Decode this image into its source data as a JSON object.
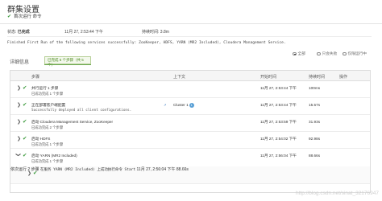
{
  "header": {
    "title": "群集设置",
    "subtitle": "首次运行 命令"
  },
  "status": {
    "state_label": "状态",
    "state_value": "已完成",
    "start_label": "11月 27, 2:53:44 下午",
    "duration_label": "持续时间",
    "duration_value": "3.8m"
  },
  "message": "Finished First Run of the following services successfully: ZooKeeper, HDFS, YARN (MR2 Included), Cloudera Management Service.",
  "details": {
    "label": "详细信息",
    "tab": "已完成 5 个步骤（共 5 个）",
    "filters": [
      "全部",
      "只会失败",
      "仅限运行中"
    ]
  },
  "table": {
    "headers": [
      "步骤",
      "上下文",
      "开始时间",
      "持续时间",
      "操作"
    ],
    "rows": [
      {
        "name": "并行运行 1 步骤",
        "status": "已成功完成 1 个步骤",
        "context": "",
        "start": "11月 27, 2:53:44 下午",
        "duration": "100ms"
      },
      {
        "name": "正在部署客户端配置",
        "status": "Successfully deployed all client configurations.",
        "context": "Cluster 1",
        "start": "11月 27, 2:53:44 下午",
        "duration": "15.57s"
      },
      {
        "name": "启动 Cloudera Management Service, ZooKeeper",
        "status": "已成功完成 2 个步骤",
        "context": "",
        "start": "11月 27, 2:53:59 下午",
        "duration": "31.93s"
      },
      {
        "name": "启动 HDFS",
        "status": "已成功完成 1 个步骤",
        "context": "",
        "start": "11月 27, 2:54:02 下午",
        "duration": "92.98s"
      },
      {
        "name": "启动 YARN (MR2 Included)",
        "status": "已成功完成 1 个步骤",
        "context": "",
        "start": "11月 27, 2:56:04 下午",
        "duration": "88.66s"
      }
    ],
    "sub_row": {
      "name": "依次运行 2 步骤",
      "status": "在服务 YARN (MR2 Included) 上成功执行命令 Start",
      "start": "11月 27, 2:56:04 下午",
      "duration": "88.66s"
    },
    "context_badge": "1"
  },
  "watermark": "http://blog.csdn.net/sinat_32176947"
}
